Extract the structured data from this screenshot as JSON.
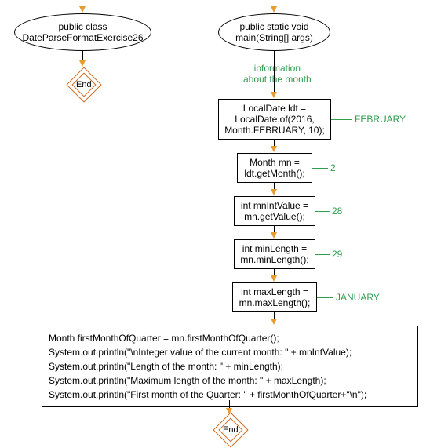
{
  "diagram": {
    "left_ellipse": "public class\nDateParseFormatExercise26",
    "right_ellipse": "public static void\nmain(String[] args)",
    "info_label": "information\nabout the month",
    "box1": "LocalDate ldt =\nLocalDate.of(2016,\nMonth.FEBRUARY, 10);",
    "box2": "Month mn =\nldt.getMonth();",
    "box3": "int mnIntValue =\nmn.getValue();",
    "box4": "int minLength =\nmn.minLength();",
    "box5": "int maxLength =\nmn.maxLength();",
    "big_box_l1": "Month firstMonthOfQuarter = mn.firstMonthOfQuarter();",
    "big_box_l2": "System.out.println(\"\\nInteger value of the current month: \" + mnIntValue);",
    "big_box_l3": "System.out.println(\"Length of the month: \" + minLength);",
    "big_box_l4": "System.out.println(\"Maximum length of the month: \" + maxLength);",
    "big_box_l5": "System.out.println(\"First month of the Quarter: \" + firstMonthOfQuarter+\"\\n\");",
    "ann_feb": "FEBRUARY",
    "ann_2": "2",
    "ann_28": "28",
    "ann_29": "29",
    "ann_jan": "JANUARY",
    "end_label": "End"
  },
  "chart_data": {
    "type": "flowchart",
    "nodes": [
      {
        "id": "class",
        "shape": "ellipse",
        "text": "public class DateParseFormatExercise26"
      },
      {
        "id": "main",
        "shape": "ellipse",
        "text": "public static void main(String[] args)"
      },
      {
        "id": "s1",
        "shape": "rect",
        "text": "LocalDate ldt = LocalDate.of(2016, Month.FEBRUARY, 10);",
        "annotation": "FEBRUARY"
      },
      {
        "id": "s2",
        "shape": "rect",
        "text": "Month mn = ldt.getMonth();",
        "annotation": "2"
      },
      {
        "id": "s3",
        "shape": "rect",
        "text": "int mnIntValue = mn.getValue();",
        "annotation": "28"
      },
      {
        "id": "s4",
        "shape": "rect",
        "text": "int minLength = mn.minLength();",
        "annotation": "29"
      },
      {
        "id": "s5",
        "shape": "rect",
        "text": "int maxLength = mn.maxLength();",
        "annotation": "JANUARY"
      },
      {
        "id": "s6",
        "shape": "rect",
        "text": "Month firstMonthOfQuarter = mn.firstMonthOfQuarter(); System.out.println(\"\\nInteger value of the current month: \" + mnIntValue); System.out.println(\"Length of the month: \" + minLength); System.out.println(\"Maximum length of the month: \" + maxLength); System.out.println(\"First month of the Quarter: \" + firstMonthOfQuarter+\"\\n\");"
      },
      {
        "id": "end1",
        "shape": "diamond",
        "text": "End"
      },
      {
        "id": "end2",
        "shape": "diamond",
        "text": "End"
      }
    ],
    "edges": [
      {
        "from": "class",
        "to": "end1"
      },
      {
        "from": "main",
        "to": "s1",
        "label": "information about the month"
      },
      {
        "from": "s1",
        "to": "s2"
      },
      {
        "from": "s2",
        "to": "s3"
      },
      {
        "from": "s3",
        "to": "s4"
      },
      {
        "from": "s4",
        "to": "s5"
      },
      {
        "from": "s5",
        "to": "s6"
      },
      {
        "from": "s6",
        "to": "end2"
      }
    ]
  }
}
